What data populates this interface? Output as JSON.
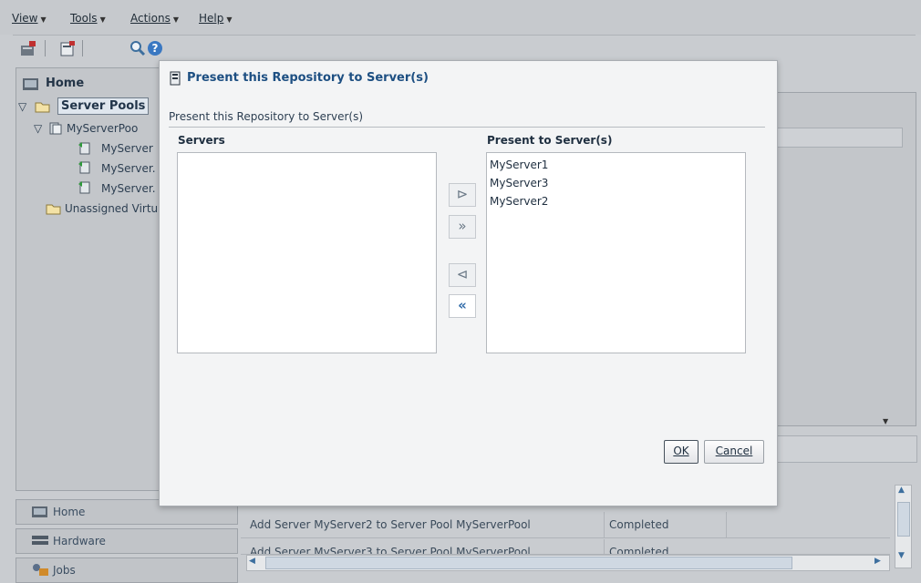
{
  "menu": {
    "view": "View",
    "tools": "Tools",
    "actions": "Actions",
    "help": "Help"
  },
  "navigator": {
    "title": "Home",
    "tree": {
      "server_pools": "Server Pools",
      "pool": "MyServerPoo",
      "servers": [
        "MyServer",
        "MyServer.",
        "MyServer."
      ],
      "unassigned": "Unassigned Virtu"
    }
  },
  "bottom_nav": {
    "home": "Home",
    "hardware": "Hardware",
    "jobs": "Jobs"
  },
  "jobs_table": {
    "rows": [
      {
        "description": "Add Server MyServer2 to Server Pool MyServerPool",
        "status": "Completed"
      },
      {
        "description": "Add Server MyServer3 to Server Pool MyServerPool",
        "status": "Completed"
      }
    ]
  },
  "dialog": {
    "title": "Present this Repository to Server(s)",
    "subtitle": "Present this Repository to Server(s)",
    "available_header": "Servers",
    "available_items": [],
    "selected_header": "Present to Server(s)",
    "selected_items": [
      "MyServer1",
      "MyServer3",
      "MyServer2"
    ],
    "shuttle": {
      "move": "⊳",
      "move_all": "»",
      "remove": "⊲",
      "remove_all": "«"
    },
    "ok": "OK",
    "cancel": "Cancel"
  },
  "colors": {
    "accent": "#1d4f82",
    "background": "#c9ccd0"
  }
}
